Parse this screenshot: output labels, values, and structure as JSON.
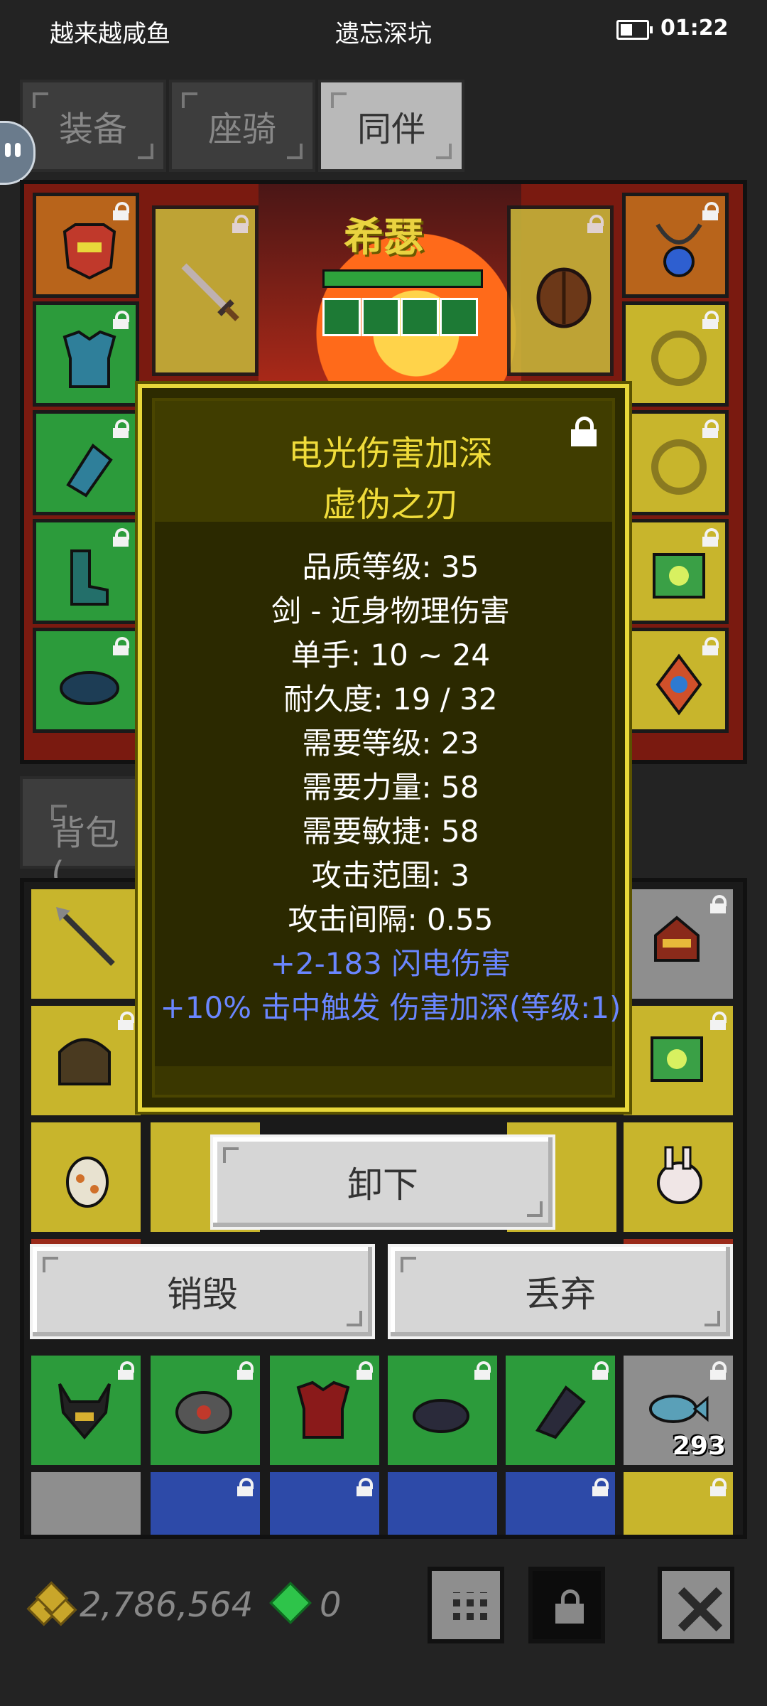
{
  "status_bar": {
    "left_text": "越来越咸鱼",
    "center_text": "遗忘深坑",
    "time": "01:22"
  },
  "tabs": [
    {
      "label": "装备",
      "active": false
    },
    {
      "label": "座骑",
      "active": false
    },
    {
      "label": "同伴",
      "active": true
    }
  ],
  "hero": {
    "name": "希瑟"
  },
  "backpack_tab": {
    "label": "背包 ("
  },
  "backpack": {
    "stack_count": "293"
  },
  "tooltip": {
    "title": "电光伤害加深",
    "subtitle": "虚伪之刃",
    "lines": [
      "品质等级: 35",
      "剑 - 近身物理伤害",
      "单手: 10 ~ 24",
      "耐久度: 19 / 32",
      "需要等级: 23",
      "需要力量: 58",
      "需要敏捷: 58",
      "攻击范围: 3",
      "攻击间隔: 0.55"
    ],
    "bonus_lines": [
      "+2-183 闪电伤害",
      "+10% 击中触发 伤害加深(等级:1)"
    ],
    "title_color": "#f0dc3a",
    "bonus_color": "#6a86ff"
  },
  "actions": {
    "unequip": "卸下",
    "destroy": "销毁",
    "discard": "丢弃"
  },
  "footer": {
    "gold": "2,786,564",
    "gems": "0"
  }
}
